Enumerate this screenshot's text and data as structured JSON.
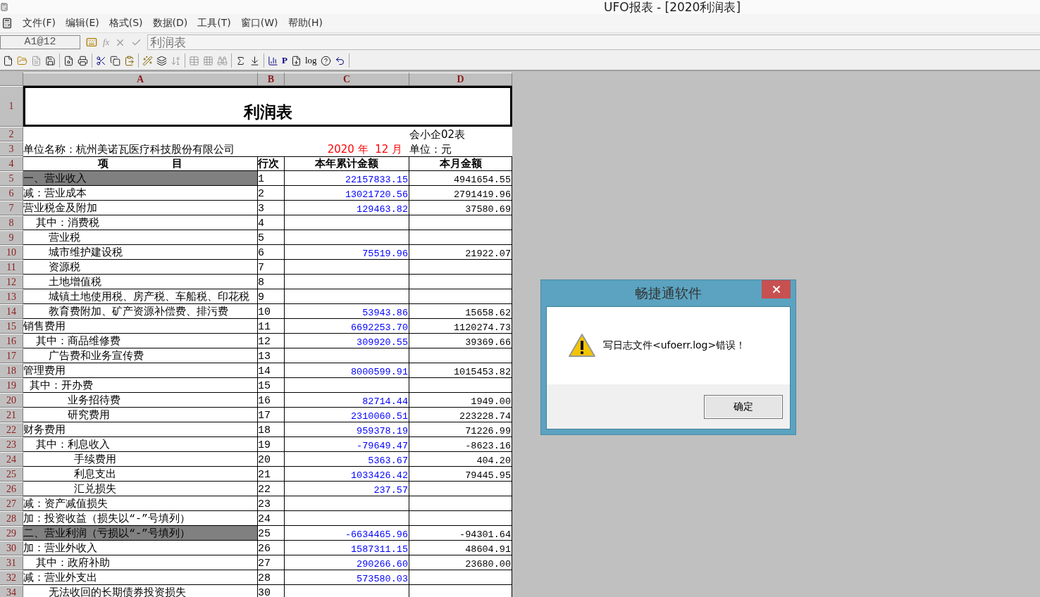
{
  "window": {
    "title": "UFO报表 - [2020利润表]"
  },
  "menu": [
    "文件(F)",
    "编辑(E)",
    "格式(S)",
    "数据(D)",
    "工具(T)",
    "窗口(W)",
    "帮助(H)"
  ],
  "formula_bar": {
    "cell": "A1@12",
    "fx": "fx",
    "content": "利润表"
  },
  "toolbar": {
    "text_buttons": [
      "P",
      "log"
    ]
  },
  "columns": [
    "A",
    "B",
    "C",
    "D"
  ],
  "rows": [
    {
      "kind": "title",
      "row": "1",
      "text": "利润表"
    },
    {
      "kind": "info",
      "row": "2",
      "right": "会小企02表"
    },
    {
      "kind": "info",
      "row": "3",
      "left": "单位名称：杭州美诺瓦医疗科技股份有限公司",
      "period": "2020 年  12 月",
      "right": "单位：元"
    },
    {
      "kind": "header",
      "row": "4",
      "cells": [
        "项          目",
        "行次",
        "本年累计金额",
        "本月金额"
      ]
    },
    {
      "kind": "data",
      "row": "5",
      "item": "一、营业收入",
      "line": "1",
      "ytd": "22157833.15",
      "month": "4941654.55",
      "highlighted": true
    },
    {
      "kind": "data",
      "row": "6",
      "item": "减：营业成本",
      "line": "2",
      "ytd": "13021720.56",
      "month": "2791419.96",
      "highlighted": false
    },
    {
      "kind": "data",
      "row": "7",
      "item": "营业税金及附加",
      "line": "3",
      "ytd": "129463.82",
      "month": "37580.69",
      "highlighted": false
    },
    {
      "kind": "data",
      "row": "8",
      "item": "  其中：消费税",
      "line": "4",
      "highlighted": false
    },
    {
      "kind": "data",
      "row": "9",
      "item": "    营业税",
      "line": "5",
      "highlighted": false
    },
    {
      "kind": "data",
      "row": "10",
      "item": "    城市维护建设税",
      "line": "6",
      "ytd": "75519.96",
      "month": "21922.07",
      "highlighted": false
    },
    {
      "kind": "data",
      "row": "11",
      "item": "    资源税",
      "line": "7",
      "highlighted": false
    },
    {
      "kind": "data",
      "row": "12",
      "item": "    土地增值税",
      "line": "8",
      "highlighted": false
    },
    {
      "kind": "data",
      "row": "13",
      "item": "    城镇土地使用税、房产税、车船税、印花税",
      "line": "9",
      "highlighted": false
    },
    {
      "kind": "data",
      "row": "14",
      "item": "    教育费附加、矿产资源补偿费、排污费",
      "line": "10",
      "ytd": "53943.86",
      "month": "15658.62",
      "highlighted": false
    },
    {
      "kind": "data",
      "row": "15",
      "item": "销售费用",
      "line": "11",
      "ytd": "6692253.70",
      "month": "1120274.73",
      "highlighted": false
    },
    {
      "kind": "data",
      "row": "16",
      "item": "  其中：商品维修费",
      "line": "12",
      "ytd": "309920.55",
      "month": "39369.66",
      "highlighted": false
    },
    {
      "kind": "data",
      "row": "17",
      "item": "    广告费和业务宣传费",
      "line": "13",
      "highlighted": false
    },
    {
      "kind": "data",
      "row": "18",
      "item": "管理费用",
      "line": "14",
      "ytd": "8000599.91",
      "month": "1015453.82",
      "highlighted": false
    },
    {
      "kind": "data",
      "row": "19",
      "item": " 其中：开办费",
      "line": "15",
      "highlighted": false
    },
    {
      "kind": "data",
      "row": "20",
      "item": "       业务招待费",
      "line": "16",
      "ytd": "82714.44",
      "month": "1949.00",
      "highlighted": false
    },
    {
      "kind": "data",
      "row": "21",
      "item": "       研究费用",
      "line": "17",
      "ytd": "2310060.51",
      "month": "223228.74",
      "highlighted": false
    },
    {
      "kind": "data",
      "row": "22",
      "item": "财务费用",
      "line": "18",
      "ytd": "959378.19",
      "month": "71226.99",
      "highlighted": false
    },
    {
      "kind": "data",
      "row": "23",
      "item": "  其中：利息收入",
      "line": "19",
      "ytd": "-79649.47",
      "month": "-8623.16",
      "highlighted": false
    },
    {
      "kind": "data",
      "row": "24",
      "item": "        手续费用",
      "line": "20",
      "ytd": "5363.67",
      "month": "404.20",
      "highlighted": false
    },
    {
      "kind": "data",
      "row": "25",
      "item": "        利息支出",
      "line": "21",
      "ytd": "1033426.42",
      "month": "79445.95",
      "highlighted": false
    },
    {
      "kind": "data",
      "row": "26",
      "item": "        汇兑损失",
      "line": "22",
      "ytd": "237.57",
      "highlighted": false
    },
    {
      "kind": "data",
      "row": "27",
      "item": "减：资产减值损失",
      "line": "23",
      "highlighted": false
    },
    {
      "kind": "data",
      "row": "28",
      "item": "加：投资收益（损失以“-”号填列）",
      "line": "24",
      "highlighted": false
    },
    {
      "kind": "data",
      "row": "29",
      "item": "二、营业利润（亏损以“-”号填列）",
      "line": "25",
      "ytd": "-6634465.96",
      "month": "-94301.64",
      "highlighted": true
    },
    {
      "kind": "data",
      "row": "30",
      "item": "加：营业外收入",
      "line": "26",
      "ytd": "1587311.15",
      "month": "48604.91",
      "highlighted": false
    },
    {
      "kind": "data",
      "row": "31",
      "item": "  其中：政府补助",
      "line": "27",
      "ytd": "290266.60",
      "month": "23680.00",
      "highlighted": false
    },
    {
      "kind": "data",
      "row": "32",
      "item": "减：营业外支出",
      "line": "28",
      "ytd": "573580.03",
      "highlighted": false
    },
    {
      "kind": "data",
      "row": "34",
      "item": "    无法收回的长期债券投资损失",
      "line": "30",
      "highlighted": false
    }
  ],
  "dialog": {
    "title": "畅捷通软件",
    "message": "写日志文件<ufoerr.log>错误！",
    "button": "确定"
  }
}
